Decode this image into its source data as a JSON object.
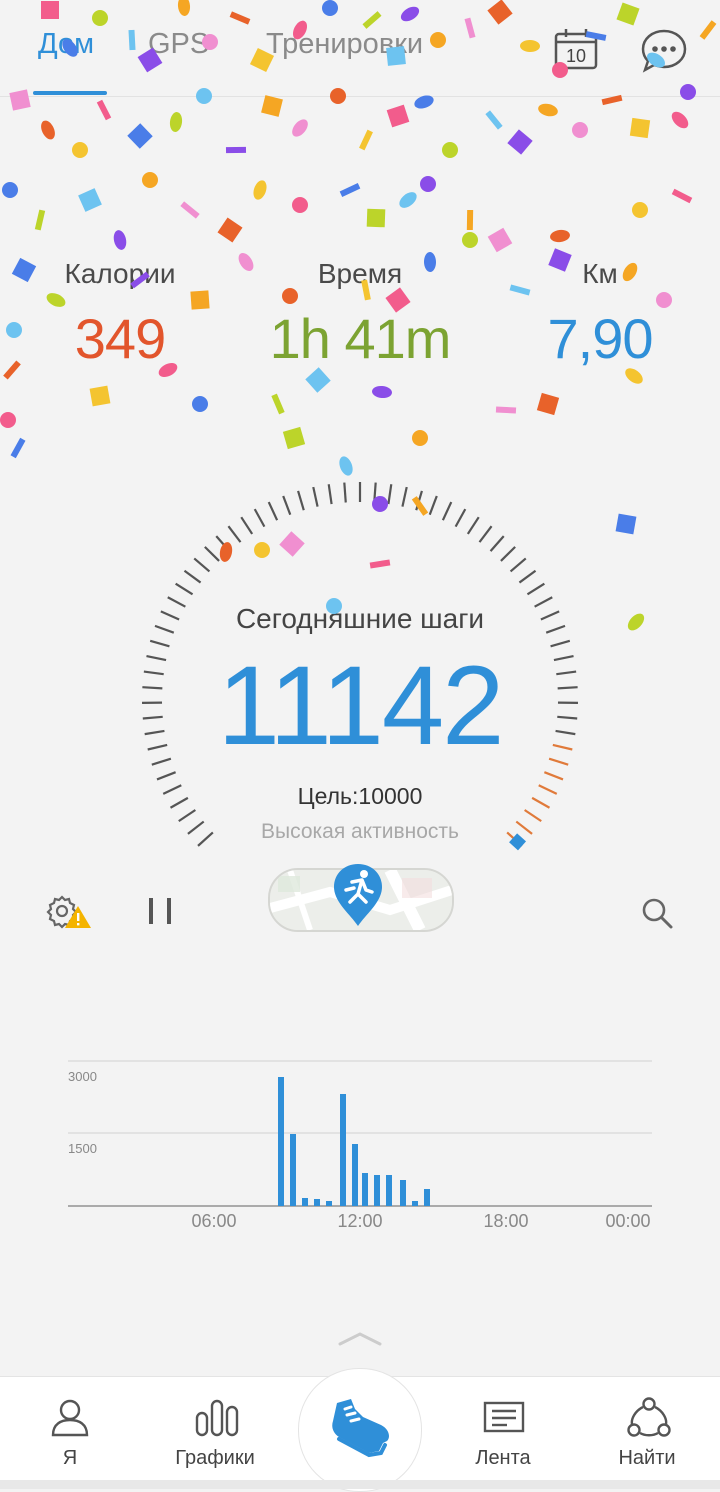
{
  "tabs": {
    "home": "Дом",
    "gps": "GPS",
    "workouts": "Тренировки"
  },
  "calendar_day": "10",
  "stats": {
    "calories_label": "Калории",
    "calories_value": "349",
    "time_label": "Время",
    "time_value": "1h 41m",
    "km_label": "Км",
    "km_value": "7,90"
  },
  "steps": {
    "title": "Сегодняшние шаги",
    "value": "11142",
    "goal": "Цель:10000",
    "activity": "Высокая активность"
  },
  "colors": {
    "accent": "#2f8fd8",
    "calories": "#e2552c",
    "time": "#7ca332",
    "km": "#2f8fd8"
  },
  "chart_data": {
    "type": "bar",
    "y_ticks": [
      "3000",
      "1500"
    ],
    "x_ticks": [
      "06:00",
      "12:00",
      "18:00",
      "00:00"
    ],
    "ylim": [
      0,
      3000
    ],
    "grid": true
  },
  "nav": {
    "me": "Я",
    "charts": "Графики",
    "feed": "Лента",
    "find": "Найти"
  },
  "icons": [
    "calendar-icon",
    "chat-icon",
    "settings-warning-icon",
    "pause-icon",
    "running-icon",
    "search-icon",
    "person-icon",
    "bar-chart-icon",
    "shoe-icon",
    "feed-icon",
    "share-icon",
    "chevron-up-icon"
  ]
}
